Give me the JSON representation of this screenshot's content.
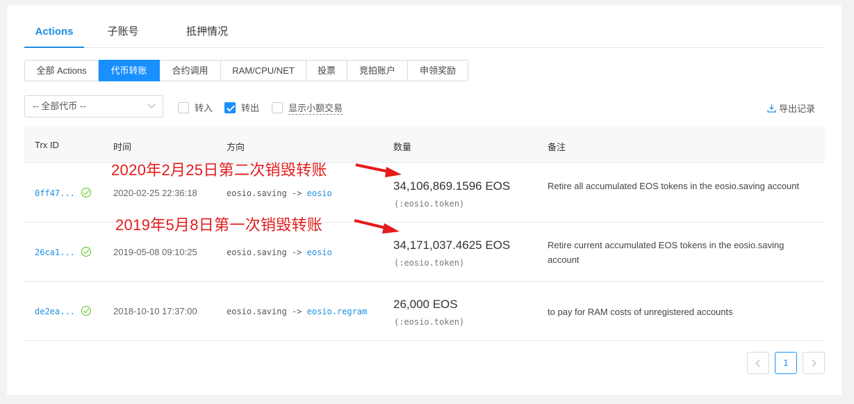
{
  "main_tabs": [
    "Actions",
    "子账号",
    "抵押情况"
  ],
  "sub_tabs": [
    "全部 Actions",
    "代币转账",
    "合约调用",
    "RAM/CPU/NET",
    "投票",
    "竞拍账户",
    "申领奖励"
  ],
  "filters": {
    "token_select": "-- 全部代币 --",
    "in_label": "转入",
    "out_label": "转出",
    "small_label": "显示小额交易",
    "export_label": "导出记录"
  },
  "table": {
    "headers": [
      "Trx ID",
      "时间",
      "方向",
      "数量",
      "备注"
    ],
    "rows": [
      {
        "trx": "0ff47...",
        "time": "2020-02-25 22:36:18",
        "from": "eosio.saving",
        "arrow": "->",
        "to": "eosio",
        "amount": "34,106,869.1596 EOS",
        "contract": "(:eosio.token)",
        "memo": "Retire all accumulated EOS tokens in the eosio.saving account"
      },
      {
        "trx": "26ca1...",
        "time": "2019-05-08 09:10:25",
        "from": "eosio.saving",
        "arrow": "->",
        "to": "eosio",
        "amount": "34,171,037.4625 EOS",
        "contract": "(:eosio.token)",
        "memo": "Retire current accumulated EOS tokens in the eosio.saving account"
      },
      {
        "trx": "de2ea...",
        "time": "2018-10-10 17:37:00",
        "from": "eosio.saving",
        "arrow": "->",
        "to": "eosio.regram",
        "amount": "26,000 EOS",
        "contract": "(:eosio.token)",
        "memo": "to pay for RAM costs of unregistered accounts"
      }
    ]
  },
  "annotations": [
    "2020年2月25日第二次销毁转账",
    "2019年5月8日第一次销毁转账"
  ],
  "pagination": {
    "current": "1"
  },
  "colors": {
    "accent": "#1890ff",
    "annotation": "#e31b1b",
    "success": "#52c41a"
  }
}
